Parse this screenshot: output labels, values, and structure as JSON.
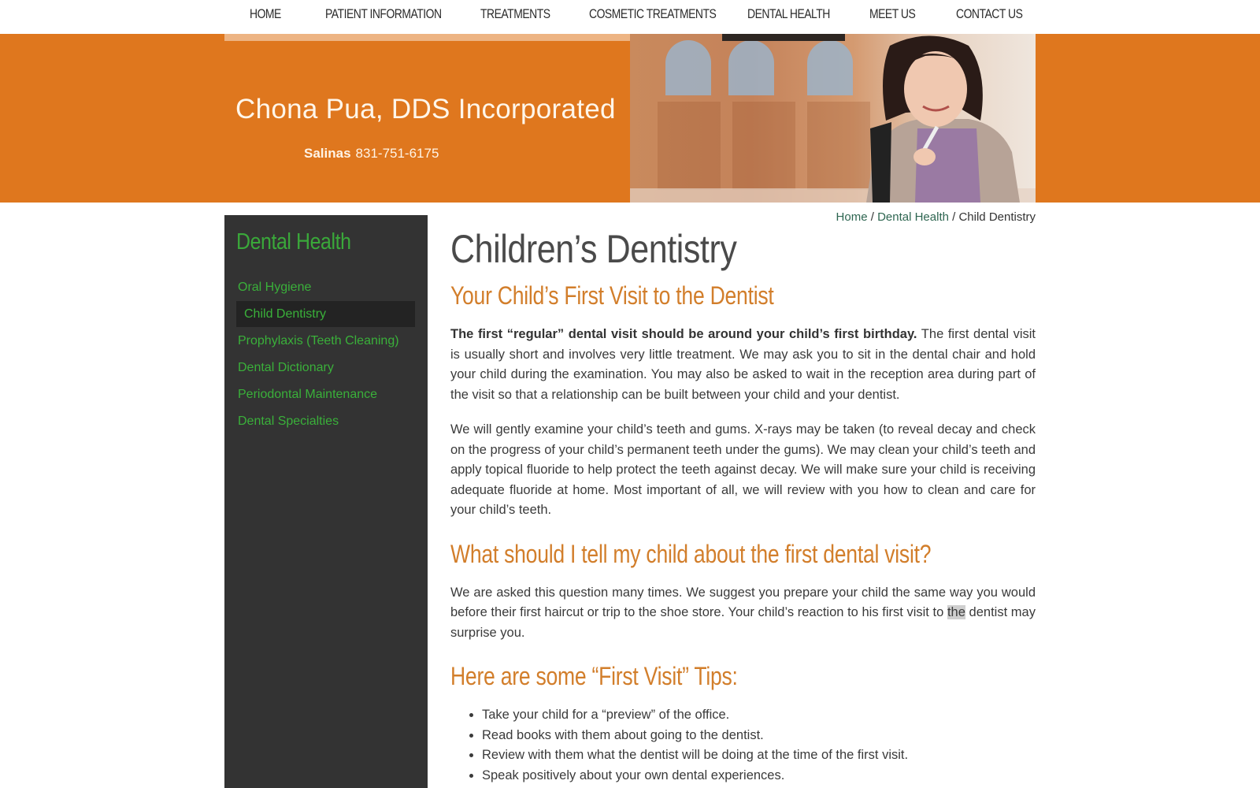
{
  "nav": {
    "items": [
      {
        "label": "HOME"
      },
      {
        "label": "PATIENT INFORMATION"
      },
      {
        "label": "TREATMENTS"
      },
      {
        "label": "COSMETIC TREATMENTS"
      },
      {
        "label": "DENTAL HEALTH",
        "active": true
      },
      {
        "label": "MEET US"
      },
      {
        "label": "CONTACT US"
      }
    ]
  },
  "banner": {
    "title": "Chona Pua, DDS Incorporated",
    "city": "Salinas",
    "phone": "831-751-6175",
    "hero_image": "smiling-student-photo",
    "color": "#df771e"
  },
  "sidebar": {
    "heading": "Dental Health",
    "items": [
      {
        "label": "Oral Hygiene"
      },
      {
        "label": "Child Dentistry",
        "active": true
      },
      {
        "label": "Prophylaxis (Teeth Cleaning)"
      },
      {
        "label": "Dental Dictionary"
      },
      {
        "label": "Periodontal Maintenance"
      },
      {
        "label": "Dental Specialties"
      }
    ]
  },
  "breadcrumb": {
    "home": "Home",
    "sep1": " / ",
    "section": "Dental Health",
    "sep2": " / ",
    "current": "Child Dentistry"
  },
  "content": {
    "title": "Children’s Dentistry",
    "h_first_visit": "Your Child’s First Visit to the Dentist",
    "p1_bold": "The first “regular” dental visit should be around your child’s first birthday.",
    "p1_rest": " The first dental visit is usually short and involves very little treatment. We may ask you to sit in the dental chair and hold your child during the examination. You may also be asked to wait in the reception area during part of the visit so that a relationship can be built between your child and your dentist.",
    "p2": "We will gently examine your child’s teeth and gums. X-rays may be taken (to reveal decay and check on the progress of your child’s permanent teeth under the gums). We may clean your child’s teeth and apply topical fluoride to help protect the teeth against decay. We will make sure your child is receiving adequate fluoride at home. Most important of all, we will review with you how to clean and care for your child’s teeth.",
    "h_tell": "What should I tell my child about the first dental visit?",
    "p3_a": "We are asked this question many times. We suggest you prepare your child the same way you would before their first haircut or trip to the shoe store. Your child’s reaction to his first visit to ",
    "p3_highlight": "the",
    "p3_b": " dentist may surprise you.",
    "h_tips": "Here are some “First Visit” Tips:",
    "tips": [
      "Take your child for a “preview” of the office.",
      "Read books with them about going to the dentist.",
      "Review with them what the dentist will be doing at the time of the first visit.",
      "Speak positively about your own dental experiences."
    ]
  },
  "colors": {
    "accent_orange": "#d27e2b",
    "sidebar_bg": "#333333",
    "sidebar_link": "#3ab03a",
    "breadcrumb_link": "#2e6651"
  }
}
